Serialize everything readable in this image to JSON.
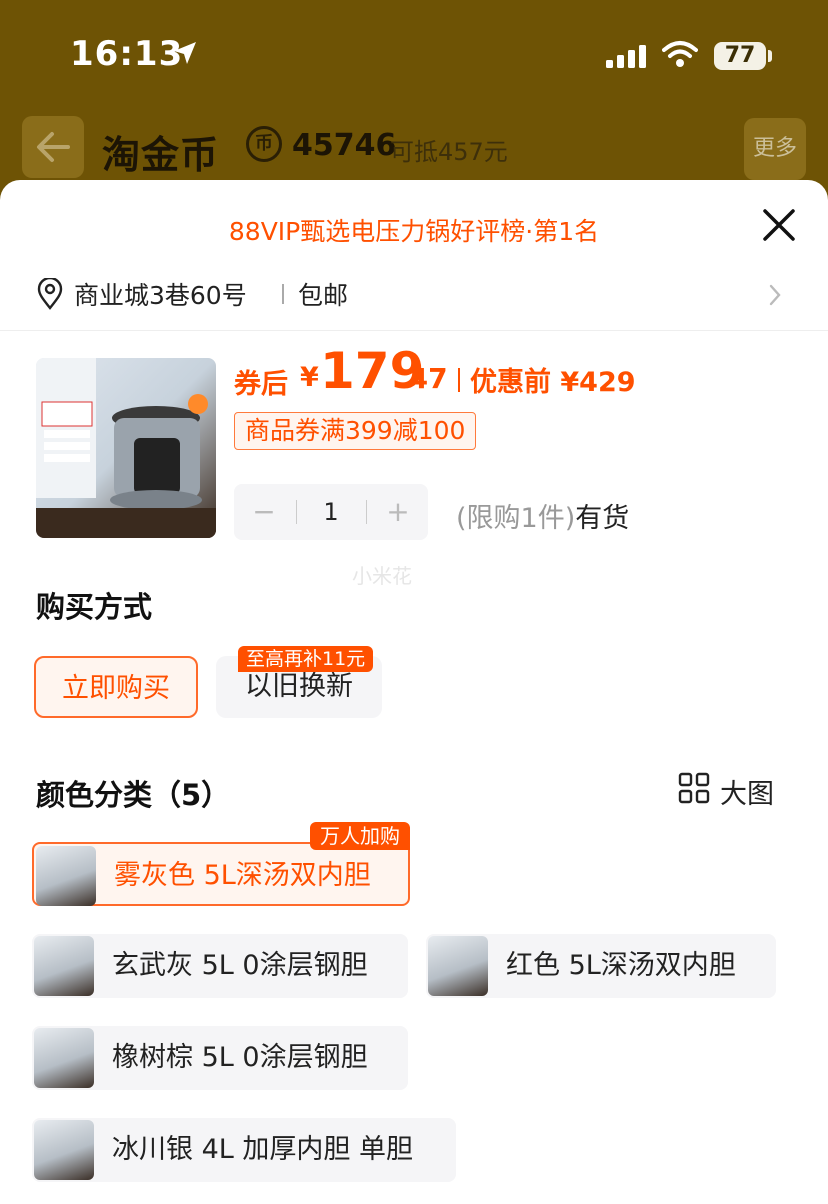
{
  "status_bar": {
    "time": "16:13",
    "battery": "77"
  },
  "navbar": {
    "brand": "淘金币",
    "coin_symbol": "币",
    "coin_count": "45746",
    "coin_worth": "可抵457元",
    "more_label": "更多"
  },
  "sheet": {
    "rank_title": "88VIP甄选电压力锅好评榜·第1名",
    "address": "商业城3巷60号",
    "shipping": "包邮"
  },
  "product": {
    "price_label": "券后",
    "currency": "¥",
    "price_int": "179",
    "price_dec": ".47",
    "original_price": "优惠前 ¥429",
    "coupon": "商品券满399减100",
    "quantity": "1",
    "minus": "−",
    "plus": "+",
    "limit": "(限购1件)",
    "stock": "有货",
    "watermark": "小米花"
  },
  "purchase": {
    "title": "购买方式",
    "buy_now": "立即购买",
    "trade_in": "以旧换新",
    "trade_in_badge": "至高再补11元"
  },
  "colors": {
    "title": "颜色分类（5）",
    "big_image": "大图",
    "variants": [
      {
        "label": "雾灰色 5L深汤双内胆",
        "badge": "万人加购"
      },
      {
        "label": "玄武灰 5L 0涂层钢胆"
      },
      {
        "label": "红色 5L深汤双内胆"
      },
      {
        "label": "橡树棕 5L 0涂层钢胆"
      },
      {
        "label": "冰川银 4L 加厚内胆 单胆"
      }
    ]
  },
  "accent_color": "#ff5000"
}
